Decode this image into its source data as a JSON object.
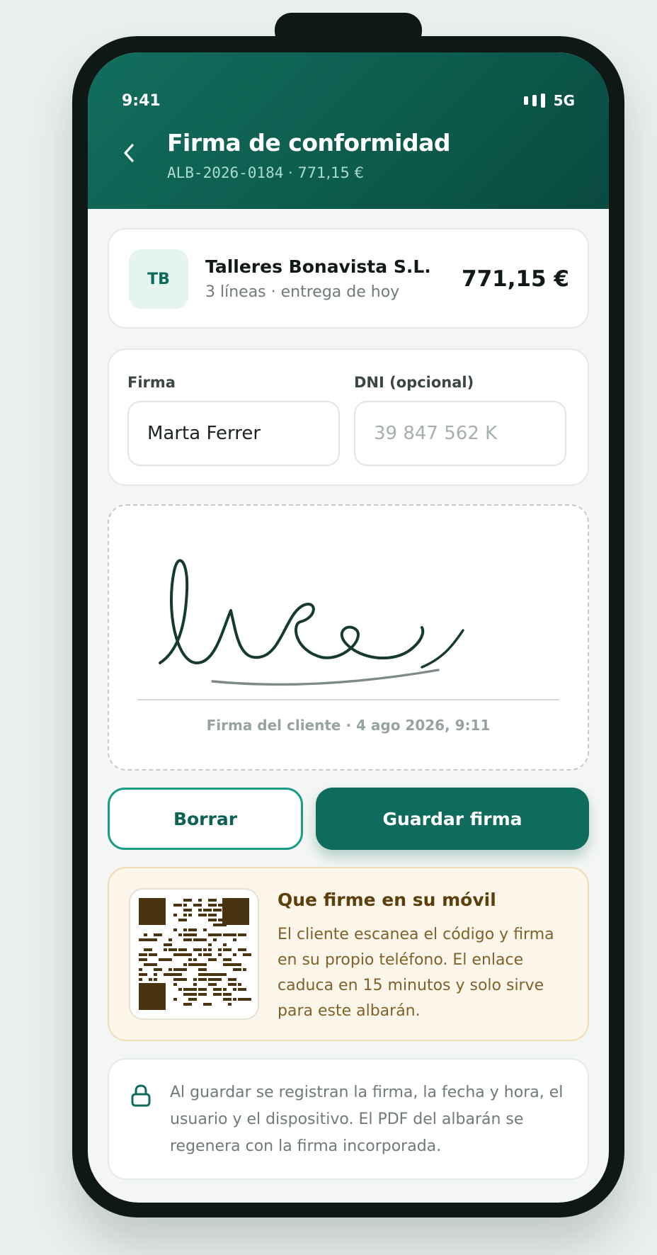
{
  "status_bar": {
    "time": "9:41",
    "network": "5G"
  },
  "header": {
    "title": "Firma de conformidad",
    "doc_id": "ALB-2026-0184",
    "separator": " · ",
    "amount": "771,15 €"
  },
  "client": {
    "initials": "TB",
    "name": "Talleres Bonavista S.L.",
    "meta": "3 líneas · entrega de hoy",
    "amount": "771,15 €"
  },
  "fields": {
    "signer_label": "Firma",
    "signer_value": "Marta Ferrer",
    "dni_label": "DNI (opcional)",
    "dni_placeholder": "39 847 562 K"
  },
  "signature": {
    "caption": "Firma del cliente · 4 ago 2026, 9:11"
  },
  "actions": {
    "clear_label": "Borrar",
    "save_label": "Guardar firma"
  },
  "mobile_sign": {
    "title": "Que firme en su móvil",
    "text": "El cliente escanea el código y firma en su propio teléfono. El enlace caduca en 15 minutos y solo sirve para este albarán."
  },
  "info": {
    "icon": "lock-icon",
    "text": "Al guardar se registran la firma, la fecha y hora, el usuario y el dispositivo. El PDF del albarán se regenera con la firma incorporada."
  },
  "colors": {
    "brand": "#0f6b5b",
    "ink": "#1a3a30",
    "qr": "#4a3410"
  }
}
